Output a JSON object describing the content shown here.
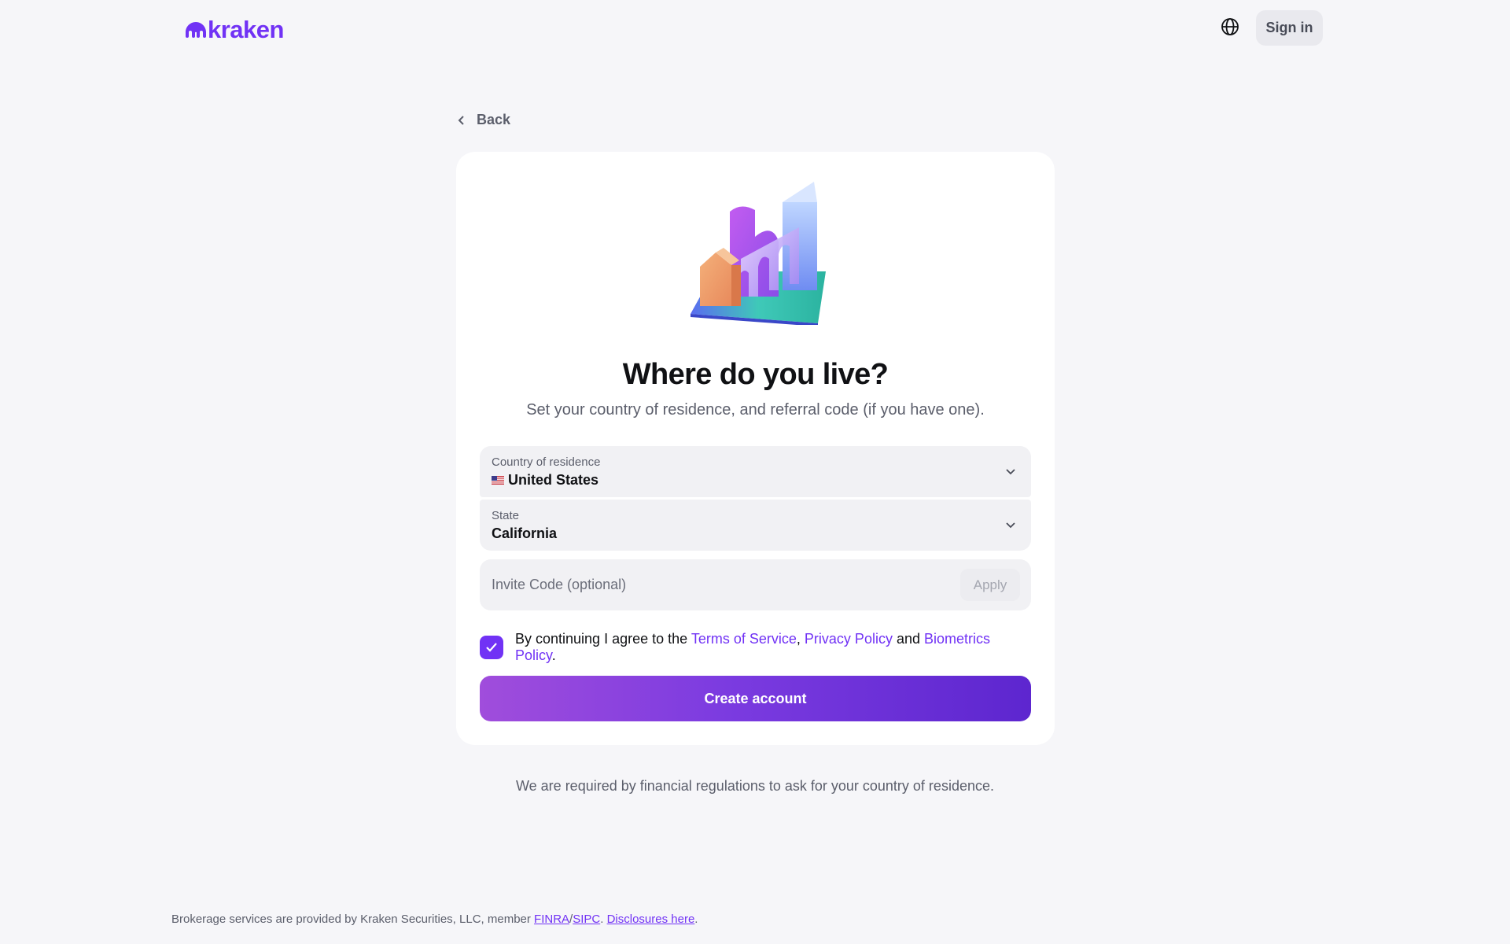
{
  "header": {
    "logo_text": "kraken",
    "globe_icon": "globe-icon",
    "signin_label": "Sign in"
  },
  "nav": {
    "back_label": "Back",
    "back_icon": "chevron-left-icon"
  },
  "card": {
    "title": "Where do you live?",
    "subtitle": "Set your country of residence, and referral code (if you have one).",
    "country": {
      "label": "Country of residence",
      "value": "United States",
      "flag": "us-flag-icon"
    },
    "state": {
      "label": "State",
      "value": "California"
    },
    "invite": {
      "placeholder": "Invite Code (optional)",
      "value": "",
      "apply_label": "Apply"
    },
    "agreement": {
      "checked": true,
      "prefix": "By continuing I agree to the",
      "terms": "Terms of Service",
      "comma": ",",
      "privacy": "Privacy Policy",
      "and": "and",
      "biometrics": "Biometrics Policy",
      "period": "."
    },
    "create_label": "Create account"
  },
  "regulation_note": "We are required by financial regulations to ask for your country of residence.",
  "footer": {
    "text": "Brokerage services are provided by Kraken Securities, LLC, member",
    "finra": "FINRA",
    "slash": "/",
    "sipc": "SIPC",
    "sep": ".",
    "disclosures": "Disclosures here",
    "end": "."
  },
  "colors": {
    "brand": "#7132f5",
    "background": "#f6f6f9",
    "card": "#ffffff",
    "field": "#f1f1f4"
  }
}
